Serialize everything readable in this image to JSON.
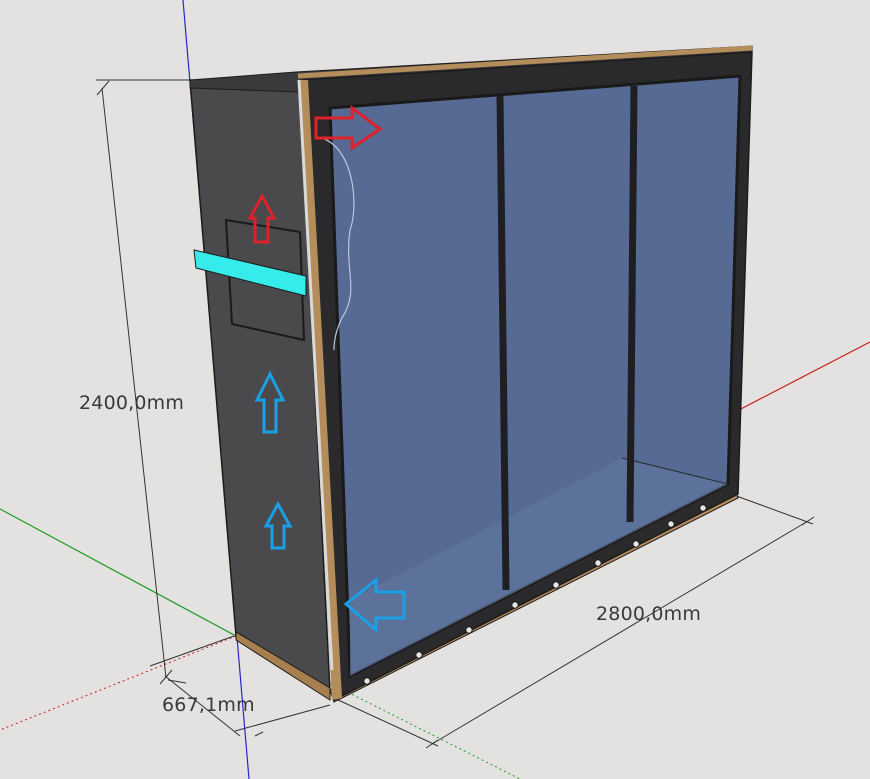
{
  "viewport": {
    "background": "#e3e2e0",
    "axis_colors": {
      "red": "#c81e1e",
      "green": "#1a9a1a",
      "blue": "#2828c8"
    }
  },
  "dimensions": {
    "height": "2400,0mm",
    "width": "2800,0mm",
    "depth": "667,1mm"
  },
  "model": {
    "colors": {
      "side_panel": "#4a4a4c",
      "frame_dark": "#2a2a2c",
      "glass": "#566a93",
      "wood_edge": "#b58d5a",
      "shelf": "#35ecea",
      "arrow_hot": "#e0202a",
      "arrow_cold": "#1aa0e8"
    },
    "arrows": [
      {
        "name": "arrow-hot-right",
        "color": "red",
        "direction": "right"
      },
      {
        "name": "arrow-hot-up",
        "color": "red",
        "direction": "up"
      },
      {
        "name": "arrow-cold-up-upper",
        "color": "blue",
        "direction": "up"
      },
      {
        "name": "arrow-cold-up-lower",
        "color": "blue",
        "direction": "up"
      },
      {
        "name": "arrow-cold-left",
        "color": "blue",
        "direction": "left"
      }
    ]
  }
}
